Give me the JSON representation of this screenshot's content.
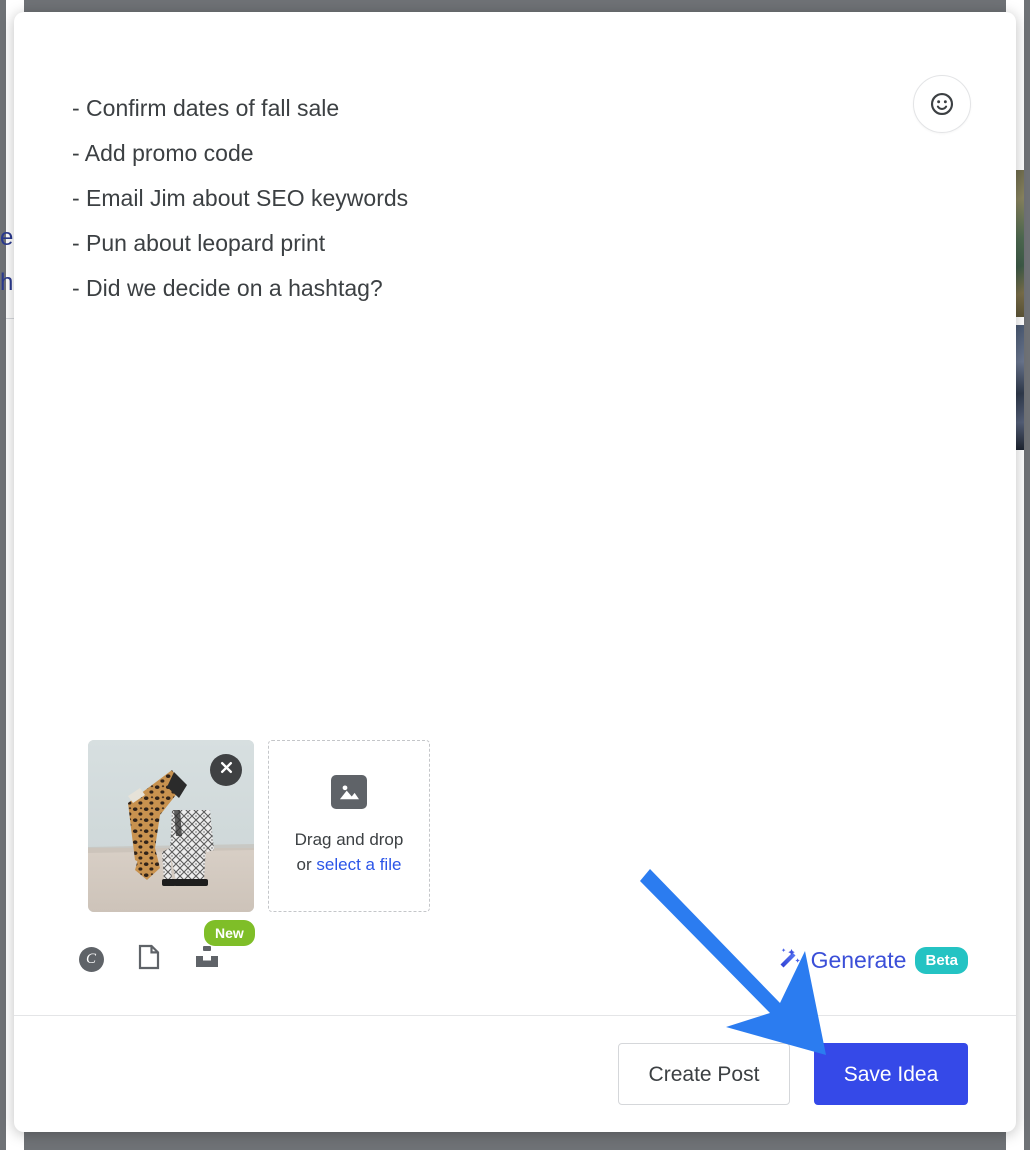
{
  "backdrop": {
    "overlay_color": "#6f7276",
    "left_text_fragments": [
      "e",
      "h"
    ],
    "left_text_color": "#2b3a8f"
  },
  "modal": {
    "emoji_button": {
      "icon": "smiley-face-icon",
      "label": "Insert emoji"
    },
    "note": {
      "lines": [
        "- Confirm dates of fall sale",
        "- Add promo code",
        "- Email Jim about SEO keywords",
        "- Pun about leopard print",
        "- Did we decide on a hashtag?"
      ]
    },
    "attachments": {
      "thumbnail": {
        "alt": "Leopard print and snakeskin ankle boots",
        "remove_icon": "close-x-icon"
      },
      "dropzone": {
        "icon": "image-placeholder-icon",
        "text_prefix": "Drag and drop",
        "text_or": "or ",
        "link_label": "select a file"
      }
    },
    "toolbar": {
      "items": [
        {
          "icon": "canva-icon",
          "glyph": "C",
          "label": "Canva"
        },
        {
          "icon": "document-icon",
          "label": "Document"
        },
        {
          "icon": "inbox-upload-icon",
          "label": "Content inbox",
          "badge": "New"
        }
      ],
      "generate": {
        "icon": "magic-wand-icon",
        "label": "Generate",
        "badge": "Beta"
      }
    },
    "footer": {
      "secondary_label": "Create Post",
      "primary_label": "Save Idea"
    }
  },
  "annotation": {
    "arrow_color": "#2b7cf0",
    "points_to": "Save Idea"
  },
  "colors": {
    "primary_button": "#3549e8",
    "link": "#2b55e8",
    "generate_text": "#3b4fd8",
    "beta_badge": "#24c3c3",
    "new_badge": "#7fbe28",
    "text": "#3c4043"
  }
}
